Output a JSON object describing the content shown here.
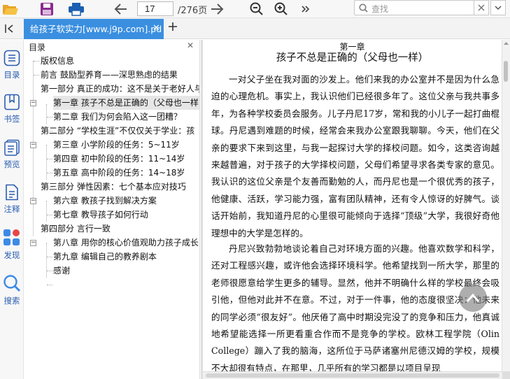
{
  "toolbar": {
    "page_current": "17",
    "page_total": "/276页",
    "search_placeholder": "查找"
  },
  "tab": {
    "title": "给孩子软实力[www.j9p.com].pd"
  },
  "rail": {
    "items": [
      {
        "label": "目录"
      },
      {
        "label": "书签"
      },
      {
        "label": "预览"
      },
      {
        "label": "注释"
      },
      {
        "label": "发现"
      },
      {
        "label": "搜索"
      }
    ]
  },
  "outline": {
    "title": "目录",
    "items": [
      {
        "label": "版权信息"
      },
      {
        "label": "前言 鼓励型养育——深思熟虑的结果"
      },
      {
        "label": "第一部分 真正的成功：这不是关于老好人与"
      },
      {
        "label": "第一章 孩子不总是正确的（父母也一样"
      },
      {
        "label": "第二章 我们为何会陷入这一团糟？"
      },
      {
        "label": "第二部分 “学校生涯”不仅仅关于学业：孩"
      },
      {
        "label": "第三章 小学阶段的任务：5~11岁"
      },
      {
        "label": "第四章 初中阶段的任务：11~14岁"
      },
      {
        "label": "第五章 高中阶段的任务：14~18岁"
      },
      {
        "label": "第三部分 弹性因素：七个基本应对技巧"
      },
      {
        "label": "第六章 教孩子找到解决方案"
      },
      {
        "label": "第七章 教导孩子如何行动"
      },
      {
        "label": "第四部分 言行一致"
      },
      {
        "label": "第八章 用你的核心价值观助力孩子成长"
      },
      {
        "label": "第九章 编辑自己的教养剧本"
      },
      {
        "label": "感谢"
      }
    ]
  },
  "document": {
    "chapter_label": "第一章",
    "chapter_title": "孩子不总是正确的（父母也一样）",
    "paragraphs": [
      "一对父子坐在我对面的沙发上。他们来我的办公室并不是因为什么急迫的心理危机。事实上，我认识他们已经很多年了。这位父亲与我共事多年，为各种学校委员会服务。儿子丹尼17岁，常和我的小儿子一起打曲棍球。丹尼遇到难题的时候，经常会来我办公室跟我聊聊。今天，他们在父亲的要求下来到这里，与我一起探讨大学的择校问题。如今，这类咨询越来越普遍，对于孩子的大学择校问题，父母们希望寻求各类专家的意见。我认识的这位父亲是个友善而勤勉的人，而丹尼也是一个很优秀的孩子，他健康、活跃，学习能力强，富有团队精神，还有令人惊讶的好脾气。谈话开始前，我知道丹尼的心里很可能倾向于选择“顶级”大学，我很好奇他理想中的大学是怎样的。",
      "丹尼兴致勃勃地谈论着自己对环境方面的兴趣。他喜欢数学和科学，还对工程感兴趣，或许他会选择环境科学。他希望找到一所大学，那里的老师很愿意给学生更多的辅导。显然，他并不明确什么样的学校最终会吸引他，但他对此并不在意。不过，对于一件事，他的态度很坚决：他未来的同学必须“很友好”。他厌倦了高中时期没完没了的竞争和压力，他真诚地希望能选择一所更看重合作而不是竞争的学校。欧林工程学院（Olin College）蹦入了我的脑海，这所位于马萨诸塞州尼德汉姆的学校，规模不大却很有特点，在那里，几乎所有的学习都是以项目呈现"
    ]
  },
  "colors": {
    "accent": "#3b8fe0",
    "icon_blue": "#2a5db0",
    "toolbar_icon": "#1c5fb0"
  }
}
